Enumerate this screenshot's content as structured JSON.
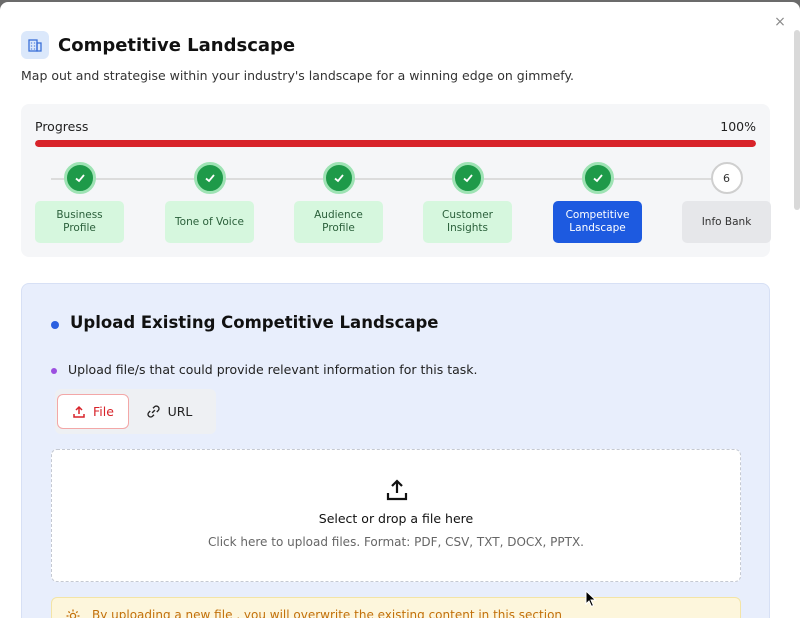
{
  "modal": {
    "close_label": "×",
    "title": "Competitive Landscape",
    "subtitle": "Map out and strategise within your industry's landscape for a winning edge on gimmefy.",
    "icon": "building-icon"
  },
  "progress": {
    "label": "Progress",
    "percent_text": "100%",
    "percent": 100,
    "fill_color": "#d8232a",
    "steps": [
      {
        "label": "Business Profile",
        "status": "complete"
      },
      {
        "label": "Tone of Voice",
        "status": "complete"
      },
      {
        "label": "Audience Profile",
        "status": "complete"
      },
      {
        "label": "Customer Insights",
        "status": "complete"
      },
      {
        "label": "Competitive Landscape",
        "status": "active"
      },
      {
        "label": "Info Bank",
        "status": "pending",
        "number": "6"
      }
    ]
  },
  "upload": {
    "title": "Upload Existing Competitive Landscape",
    "hint": "Upload file/s that could provide relevant information for this task.",
    "tabs": {
      "file": "File",
      "url": "URL"
    },
    "dropzone_title": "Select or drop a file here",
    "dropzone_sub": "Click here to upload files. Format: PDF, CSV, TXT, DOCX, PPTX.",
    "warning": "By uploading a new file , you will overwrite the existing content in this section"
  },
  "colors": {
    "accent_blue": "#1d5ae0",
    "success_green": "#1e9a49",
    "warning_orange": "#c2700b"
  }
}
